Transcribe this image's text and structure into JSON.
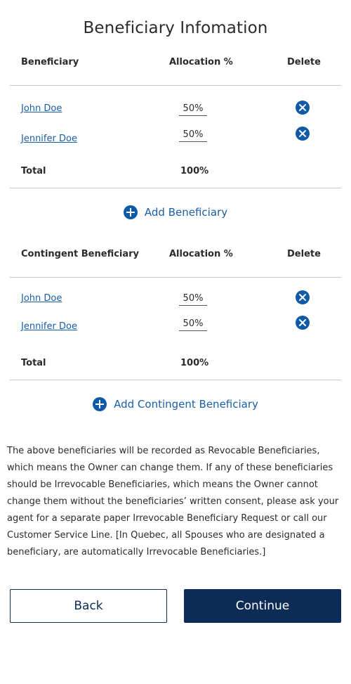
{
  "page": {
    "title": "Beneficiary Infomation"
  },
  "primary": {
    "header": {
      "name": "Beneficiary",
      "allocation": "Allocation %",
      "delete": "Delete"
    },
    "rows": [
      {
        "name": "John Doe",
        "allocation": "50%"
      },
      {
        "name": "Jennifer Doe",
        "allocation": "50%"
      }
    ],
    "total": {
      "label": "Total",
      "value": "100%"
    },
    "add_label": "Add Beneficiary"
  },
  "contingent": {
    "header": {
      "name": "Contingent Beneficiary",
      "allocation": "Allocation %",
      "delete": "Delete"
    },
    "rows": [
      {
        "name": "John Doe",
        "allocation": "50%"
      },
      {
        "name": "Jennifer Doe",
        "allocation": "50%"
      }
    ],
    "total": {
      "label": "Total",
      "value": "100%"
    },
    "add_label": "Add Contingent Beneficiary"
  },
  "notice": "The above beneficiaries will be recorded as Revocable Beneficiaries, which means the Owner can change them.  If any of these beneficiaries should be Irrevocable Beneficiaries, which means the Owner cannot change them without the beneficiaries’ written consent, please ask your agent for a separate paper Irrevocable Beneficiary Request or call our Customer Service Line.  [In Quebec, all Spouses who are designated a beneficiary, are automatically Irrevocable Beneficiaries.]",
  "buttons": {
    "back": "Back",
    "continue": "Continue"
  },
  "colors": {
    "link": "#1a5ea8",
    "accent": "#0f5aa8",
    "primary_button": "#0c2b57",
    "divider": "#c9c9c9"
  },
  "icons": {
    "delete": "close-circle-icon",
    "add": "plus-circle-icon"
  }
}
